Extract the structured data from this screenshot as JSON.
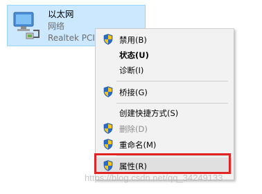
{
  "adapter": {
    "name": "以太网",
    "status": "网络",
    "device": "Realtek PCIe"
  },
  "menu": {
    "items": [
      {
        "label": "禁用(B)",
        "icon": "shield-icon",
        "bold": false,
        "disabled": false
      },
      {
        "label": "状态(U)",
        "icon": "",
        "bold": true,
        "disabled": false
      },
      {
        "label": "诊断(I)",
        "icon": "",
        "bold": false,
        "disabled": false
      },
      {
        "label": "桥接(G)",
        "icon": "shield-icon",
        "bold": false,
        "disabled": false
      },
      {
        "label": "创建快捷方式(S)",
        "icon": "",
        "bold": false,
        "disabled": false
      },
      {
        "label": "删除(D)",
        "icon": "shield-icon",
        "bold": false,
        "disabled": true
      },
      {
        "label": "重命名(M)",
        "icon": "shield-icon",
        "bold": false,
        "disabled": false
      },
      {
        "label": "属性(R)",
        "icon": "shield-icon",
        "bold": false,
        "disabled": false,
        "highlighted": true
      }
    ]
  },
  "colors": {
    "tile_bg": "#cce8ff",
    "tile_border": "#99d1ff",
    "menu_bg": "#f2f2f2",
    "highlight_border": "#e32222",
    "shield_blue": "#2a6ccb",
    "shield_yellow": "#f5c518"
  },
  "watermark": "https://blog.csdn.net/qq_34249133"
}
